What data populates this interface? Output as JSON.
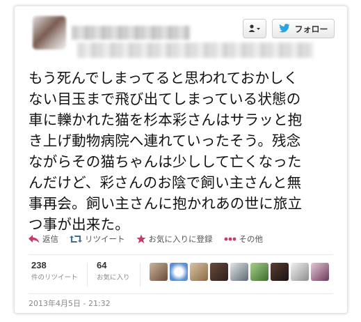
{
  "header": {
    "follow_label": "フォロー",
    "user_menu_icon": "user-icon"
  },
  "tweet": {
    "lines": [
      "もう死んでしまってると思われておかしく",
      "ない目玉まで飛び出てしまっている状態の",
      "車に轢かれた猫を杉本彩さんはサラッと抱",
      "き上げ動物病院へ連れていったそう。残念",
      "ながらその猫ちゃんは少しして亡くなった",
      "んだけど、彩さんのお陰で飼い主さんと無",
      "事再会。飼い主さんに抱かれあの世に旅立",
      "つ事が出来た。"
    ]
  },
  "actions": {
    "reply": "返信",
    "retweet": "リツイート",
    "favorite": "お気に入りに登録",
    "more": "その他"
  },
  "stats": {
    "retweets_count": "238",
    "retweets_label": "件のリツイート",
    "favorites_count": "64",
    "favorites_label": "お気に入り"
  },
  "timestamp": "2013年4月5日 - 21:32",
  "colors": {
    "reply": "#c43b6a",
    "retweet": "#3d6e9a",
    "favorite": "#c43b6a",
    "twitter_blue": "#2fa3e0"
  }
}
